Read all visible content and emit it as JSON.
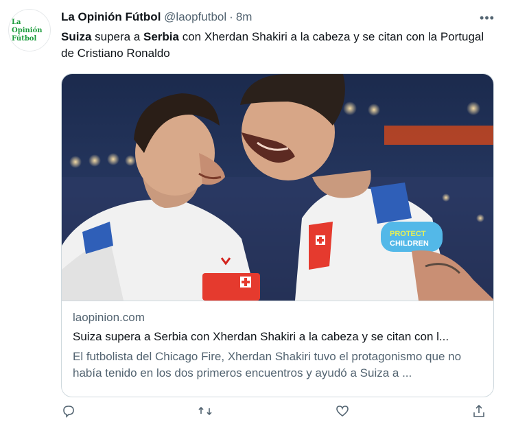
{
  "tweet": {
    "author_name": "La Opinión Fútbol",
    "handle": "@laopfutbol",
    "separator": "·",
    "time": "8m",
    "more_label": "•••",
    "text": {
      "part1": "Suiza",
      "part2": " supera a ",
      "part3": "Serbia",
      "part4": " con Xherdan Shakiri a la cabeza y se citan con la Portugal de Cristiano Ronaldo"
    }
  },
  "avatar": {
    "logo_lines": [
      "La",
      "Opinión",
      "Fútbol"
    ],
    "logo_color": "#1e9c3e"
  },
  "card": {
    "domain": "laopinion.com",
    "title": "Suiza supera a Serbia con Xherdan Shakiri a la cabeza y se citan con l...",
    "description": "El futbolista del Chicago Fire, Xherdan Shakiri tuvo el protagonismo que no había tenido en los dos primeros encuentros y ayudó a Suiza a ...",
    "image_icon": "photo-two-players-celebrating",
    "armband_text": [
      "PROTECT",
      "CHILDREN"
    ]
  },
  "actions": [
    "reply-icon",
    "retweet-icon",
    "like-icon",
    "share-icon"
  ],
  "colors": {
    "text_primary": "#0f1419",
    "text_secondary": "#536471",
    "border": "#cfd9de"
  }
}
